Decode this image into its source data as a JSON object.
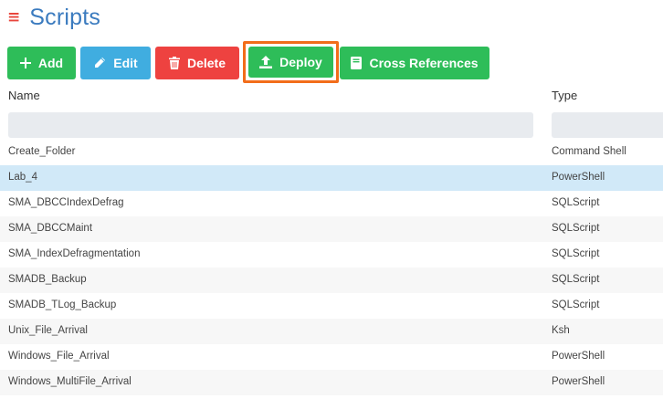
{
  "header": {
    "title": "Scripts",
    "menu_icon": "hamburger-icon"
  },
  "toolbar": {
    "add_label": "Add",
    "edit_label": "Edit",
    "delete_label": "Delete",
    "deploy_label": "Deploy",
    "xref_label": "Cross References"
  },
  "table": {
    "columns": [
      "Name",
      "Type"
    ],
    "rows": [
      {
        "name": "Create_Folder",
        "type": "Command Shell"
      },
      {
        "name": "Lab_4",
        "type": "PowerShell"
      },
      {
        "name": "SMA_DBCCIndexDefrag",
        "type": "SQLScript"
      },
      {
        "name": "SMA_DBCCMaint",
        "type": "SQLScript"
      },
      {
        "name": "SMA_IndexDefragmentation",
        "type": "SQLScript"
      },
      {
        "name": "SMADB_Backup",
        "type": "SQLScript"
      },
      {
        "name": "SMADB_TLog_Backup",
        "type": "SQLScript"
      },
      {
        "name": "Unix_File_Arrival",
        "type": "Ksh"
      },
      {
        "name": "Windows_File_Arrival",
        "type": "PowerShell"
      },
      {
        "name": "Windows_MultiFile_Arrival",
        "type": "PowerShell"
      }
    ],
    "selected_row": 1
  },
  "colors": {
    "title": "#3b7bbf",
    "green": "#2ebd59",
    "blue": "#40ade0",
    "red": "#ee4240",
    "highlight": "#f26d1a",
    "selected": "#d1e9f8"
  }
}
